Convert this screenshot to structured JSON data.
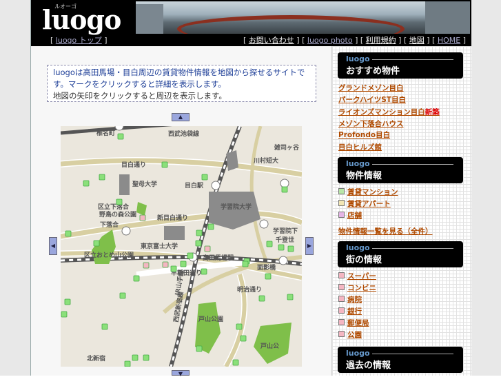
{
  "header": {
    "logo_kana": "ルオーゴ",
    "logo_word": "luogo",
    "nav_left": "luogo トップ",
    "nav_right": [
      "お問い合わせ",
      "luogo photo",
      "利用規約",
      "地図",
      "HOME"
    ]
  },
  "intro": {
    "line1": "luogoは高田馬場・目白周辺の賃貸物件情報を地図から探せるサイトです。マークをクリックすると詳細を表示します。",
    "line2": "地図の矢印をクリックすると周辺を表示します。"
  },
  "map": {
    "labels": [
      "椎名町",
      "西武池袋線",
      "雑司ヶ谷",
      "川村短大",
      "目白通り",
      "聖母大学",
      "目白駅",
      "学習院大学",
      "区立下落合",
      "野鳥の森公園",
      "新目白通り",
      "下落合",
      "東京富士大学",
      "学習院下",
      "区立おとめ山公園",
      "高田馬場駅",
      "面影橋",
      "早稲田通り",
      "明治通り",
      "戸山公園",
      "戸山公",
      "北新宿",
      "西武新宿線",
      "JR山手線",
      "千登世"
    ],
    "pin_count": 40
  },
  "sidebar": {
    "recommend_title": "おすすめ物件",
    "recommend": [
      "グランドメゾン目白",
      "パークハイツST目白",
      "ライオンズマンション目白",
      "メゾン下落合ハウス",
      "Profondo目白",
      "目白ヒルズ館"
    ],
    "recommend_highlight": "新築",
    "property_title": "物件情報",
    "property": [
      "賃貸マンション",
      "賃貸アパート",
      "店舗"
    ],
    "property_more": "物件情報一覧を見る（全件）",
    "town_title": "街の情報",
    "town": [
      "スーパー",
      "コンビニ",
      "病院",
      "銀行",
      "郵便局",
      "公園"
    ],
    "past_title": "過去の情報",
    "brand": "luogo"
  },
  "colors": {
    "accent": "#b04a00",
    "red": "#d00",
    "pin_green": "#8be07a",
    "pin_pink": "#f4b6c2"
  }
}
